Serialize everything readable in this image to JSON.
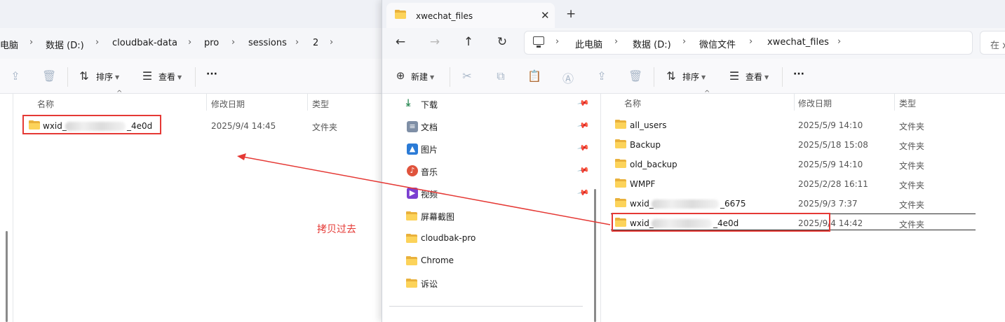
{
  "left_window": {
    "breadcrumb": [
      "电脑",
      "数据 (D:)",
      "cloudbak-data",
      "pro",
      "sessions",
      "2"
    ],
    "toolbar": {
      "sort_label": "排序",
      "view_label": "查看",
      "more_label": "···"
    },
    "columns": {
      "name": "名称",
      "date": "修改日期",
      "type": "类型"
    },
    "rows": [
      {
        "name_prefix": "wxid_",
        "name_suffix": "_4e0d",
        "date": "2025/9/4 14:45",
        "type": "文件夹"
      }
    ]
  },
  "right_window": {
    "tab": {
      "title": "xwechat_files",
      "close": "✕",
      "add": "+"
    },
    "nav": {
      "back": "←",
      "forward": "→",
      "up": "↑",
      "refresh": "↻"
    },
    "breadcrumb": [
      "此电脑",
      "数据 (D:)",
      "微信文件",
      "xwechat_files"
    ],
    "search_placeholder": "在 x",
    "toolbar": {
      "new_label": "新建",
      "sort_label": "排序",
      "view_label": "查看",
      "more_label": "···"
    },
    "sidebar": [
      {
        "label": "下载",
        "icon": "download-icon",
        "pinned": true
      },
      {
        "label": "文档",
        "icon": "document-icon",
        "pinned": true
      },
      {
        "label": "图片",
        "icon": "picture-icon",
        "pinned": true
      },
      {
        "label": "音乐",
        "icon": "music-icon",
        "pinned": true
      },
      {
        "label": "视频",
        "icon": "video-icon",
        "pinned": true
      },
      {
        "label": "屏幕截图",
        "icon": "folder-icon",
        "pinned": false
      },
      {
        "label": "cloudbak-pro",
        "icon": "folder-icon",
        "pinned": false
      },
      {
        "label": "Chrome",
        "icon": "folder-icon",
        "pinned": false
      },
      {
        "label": "诉讼",
        "icon": "folder-icon",
        "pinned": false
      }
    ],
    "columns": {
      "name": "名称",
      "date": "修改日期",
      "type": "类型"
    },
    "rows": [
      {
        "name": "all_users",
        "date": "2025/5/9 14:10",
        "type": "文件夹"
      },
      {
        "name": "Backup",
        "date": "2025/5/18 15:08",
        "type": "文件夹"
      },
      {
        "name": "old_backup",
        "date": "2025/5/9 14:10",
        "type": "文件夹"
      },
      {
        "name": "WMPF",
        "date": "2025/2/28 16:11",
        "type": "文件夹"
      },
      {
        "name_prefix": "wxid_",
        "name_suffix": "_6675",
        "date": "2025/9/3 7:37",
        "type": "文件夹"
      },
      {
        "name_prefix": "wxid_",
        "name_suffix": "_4e0d",
        "date": "2025/9/4 14:42",
        "type": "文件夹"
      }
    ]
  },
  "annotation": {
    "text": "拷贝过去",
    "color": "#e53935"
  }
}
